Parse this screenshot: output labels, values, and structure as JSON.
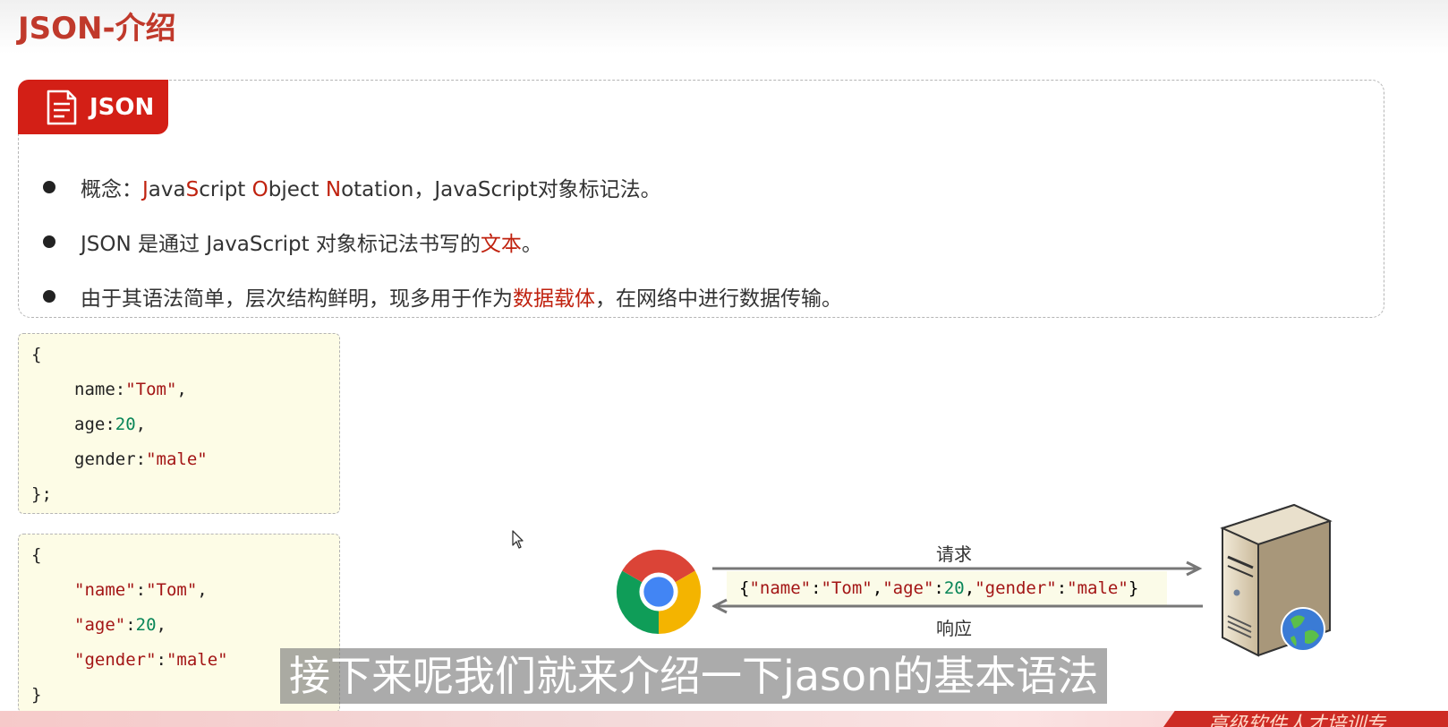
{
  "slide": {
    "title": "JSON-介绍",
    "tag_label": "JSON",
    "bullets": {
      "b1": {
        "prefix": "概念：",
        "j": "J",
        "ava": "ava",
        "s": "S",
        "cript": "cript ",
        "o": "O",
        "bject": "bject ",
        "n": "N",
        "otation": "otation，JavaScript对象标记法。"
      },
      "b2": {
        "text": "JSON 是通过 JavaScript 对象标记法书写的",
        "highlight": "文本",
        "suffix": "。"
      },
      "b3": {
        "text": "由于其语法简单，层次结构鲜明，现多用于作为",
        "highlight": "数据载体",
        "suffix": "，在网络中进行数据传输。"
      }
    }
  },
  "code_js": {
    "open": "{",
    "name_key": "name:",
    "name_val": "\"Tom\"",
    "comma1": ",",
    "age_key": "age:",
    "age_val": "20",
    "comma2": ",",
    "gender_key": "gender:",
    "gender_val": "\"male\"",
    "close": "};"
  },
  "code_json": {
    "open": "{",
    "name_key": "\"name\"",
    "colon1": ":",
    "name_val": "\"Tom\"",
    "comma1": ",",
    "age_key": "\"age\"",
    "colon2": ":",
    "age_val": "20",
    "comma2": ",",
    "gender_key": "\"gender\"",
    "colon3": ":",
    "gender_val": "\"male\"",
    "close": "}"
  },
  "flow": {
    "request_label": "请求",
    "response_label": "响应",
    "payload": {
      "p1": "{",
      "k1": "\"name\"",
      "c1": ":",
      "v1": "\"Tom\"",
      "s1": ",",
      "k2": "\"age\"",
      "c2": ":",
      "v2": "20",
      "s2": ",",
      "k3": "\"gender\"",
      "c3": ":",
      "v3": "\"male\"",
      "p2": "}"
    }
  },
  "subtitle": "接下来呢我们就来介绍一下jason的基本语法",
  "footer_text": "高级软件人才培训专",
  "colors": {
    "accent": "#d31f16",
    "title": "#c0392b",
    "code_bg": "#fdfce6",
    "string": "#a31515",
    "number": "#098658"
  },
  "icons": [
    "document-icon",
    "chrome-icon",
    "server-icon",
    "globe-icon",
    "arrow-right-icon",
    "arrow-left-icon",
    "mouse-cursor-icon"
  ]
}
